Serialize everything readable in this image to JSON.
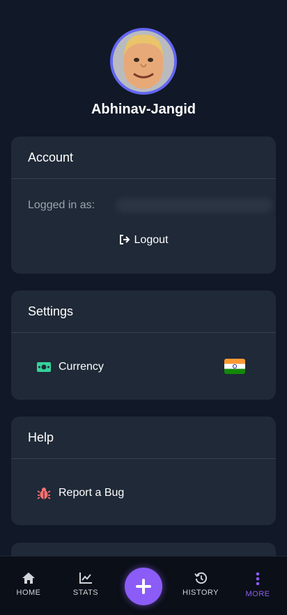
{
  "profile": {
    "username": "Abhinav-Jangid"
  },
  "account": {
    "title": "Account",
    "logged_in_label": "Logged in as:",
    "logout_label": "Logout"
  },
  "settings": {
    "title": "Settings",
    "currency_label": "Currency",
    "currency_flag_icon": "india-flag-icon"
  },
  "help": {
    "title": "Help",
    "report_bug_label": "Report a Bug"
  },
  "nav": {
    "home": "HOME",
    "stats": "STATS",
    "history": "HISTORY",
    "more": "MORE",
    "add_icon": "plus-icon"
  },
  "colors": {
    "background": "#111827",
    "card": "#1f2937",
    "accent": "#8b5cf6",
    "avatar_border": "#6366f1",
    "currency_icon": "#34d399",
    "bug_icon": "#f87171"
  }
}
